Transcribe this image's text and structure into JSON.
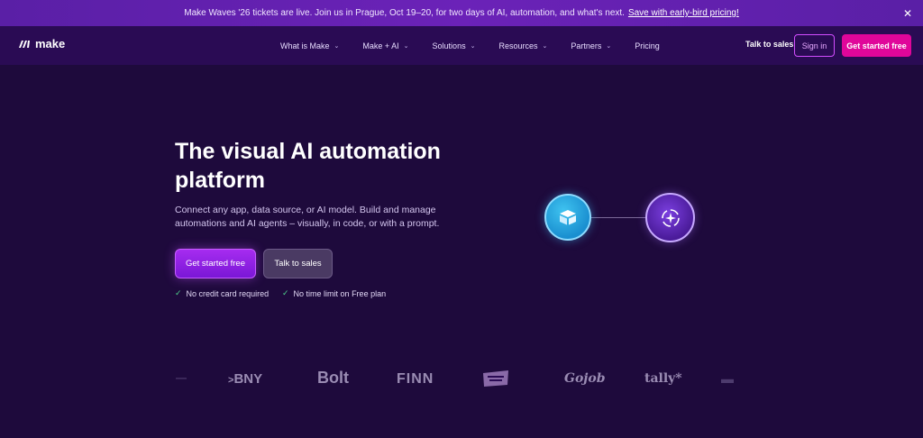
{
  "banner": {
    "text": "Make Waves '26 tickets are live. Join us in Prague, Oct 19–20, for two days of AI, automation, and what's next.",
    "link": "Save with early-bird pricing!",
    "close": "✕"
  },
  "nav": {
    "logo": "make",
    "menu": [
      {
        "label": "What is Make",
        "chevron": "⌄"
      },
      {
        "label": "Make + AI",
        "chevron": "⌄"
      },
      {
        "label": "Solutions",
        "chevron": "⌄"
      },
      {
        "label": "Resources",
        "chevron": "⌄"
      },
      {
        "label": "Partners",
        "chevron": "⌄"
      },
      {
        "label": "Pricing"
      }
    ],
    "talk_to_sales": "Talk to sales",
    "sign_in": "Sign in",
    "get_started": "Get started free"
  },
  "hero": {
    "title": "The visual AI automation platform",
    "subtitle": "Connect any app, data source, or AI model. Build and manage automations and AI agents – visually, in code, or with a prompt.",
    "primary_cta": "Get started free",
    "secondary_cta": "Talk to sales",
    "checks": [
      "No credit card required",
      "No time limit on Free plan"
    ]
  },
  "clients": [
    "BNY",
    "Bolt",
    "FINN",
    "Gojob",
    "tally*"
  ],
  "colors": {
    "background": "#1e0a3c",
    "accent_pink": "#e0069a",
    "accent_purple": "#a62cf0"
  }
}
